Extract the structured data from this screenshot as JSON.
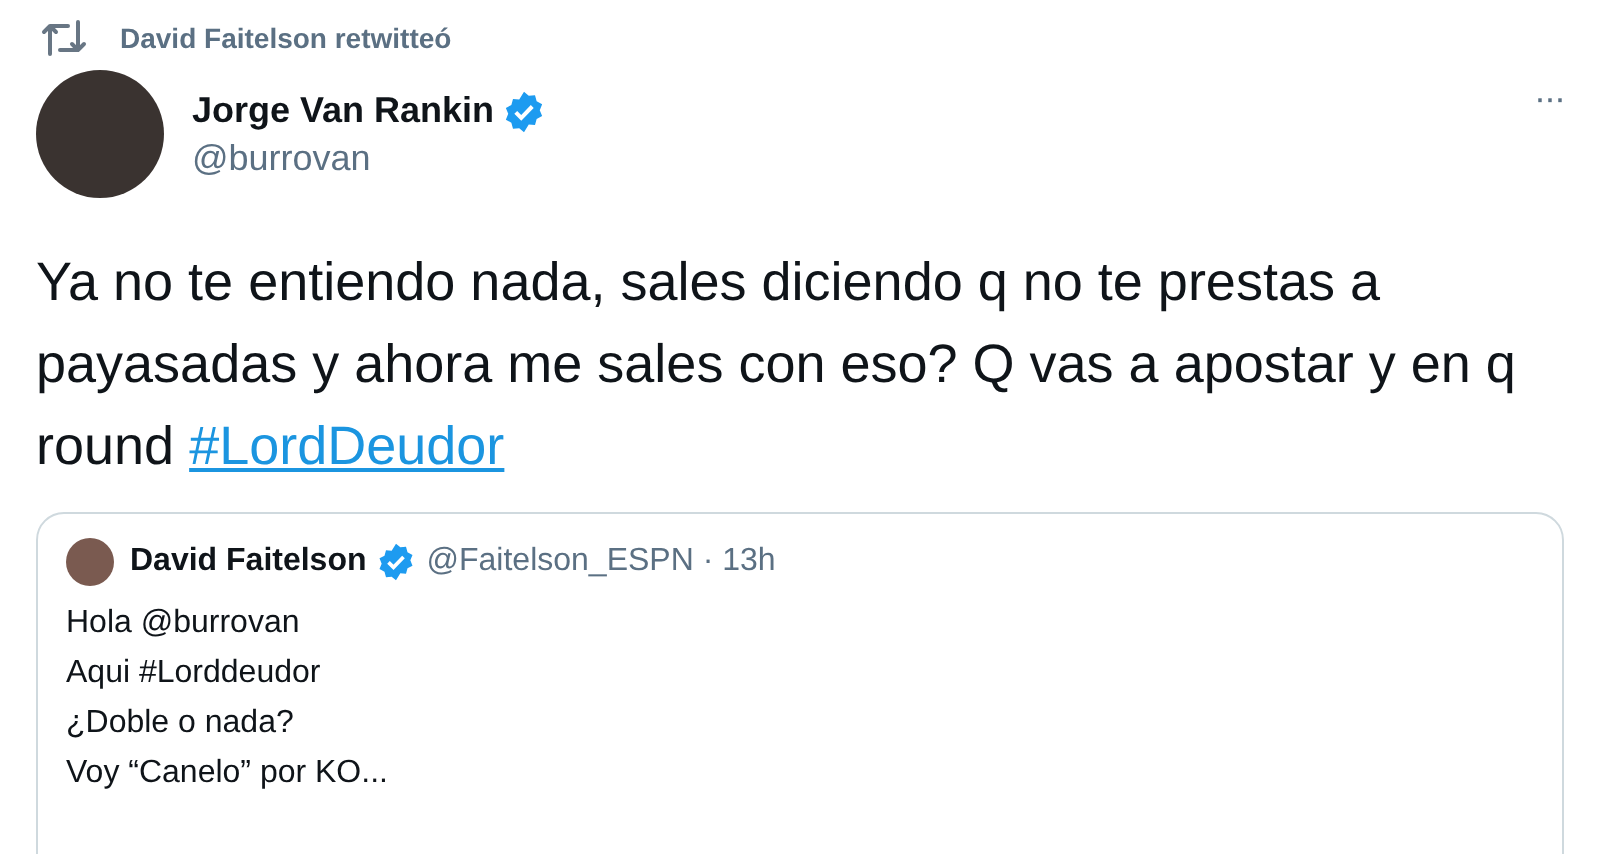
{
  "retweet": {
    "text": "David Faitelson retwitteó"
  },
  "author": {
    "name": "Jorge Van Rankin",
    "verified": true,
    "handle": "@burrovan"
  },
  "more": "···",
  "tweet": {
    "text": "Ya no te entiendo nada, sales diciendo q no te prestas a payasadas y ahora me sales con eso? Q vas a apostar y en q round",
    "hashtag": "#LordDeudor"
  },
  "quoted": {
    "name": "David Faitelson",
    "verified": true,
    "meta": "@Faitelson_ESPN · 13h",
    "lines": [
      "Hola @burrovan",
      "Aqui #Lorddeudor",
      "¿Doble o nada?",
      "Voy “Canelo” por KO..."
    ]
  }
}
